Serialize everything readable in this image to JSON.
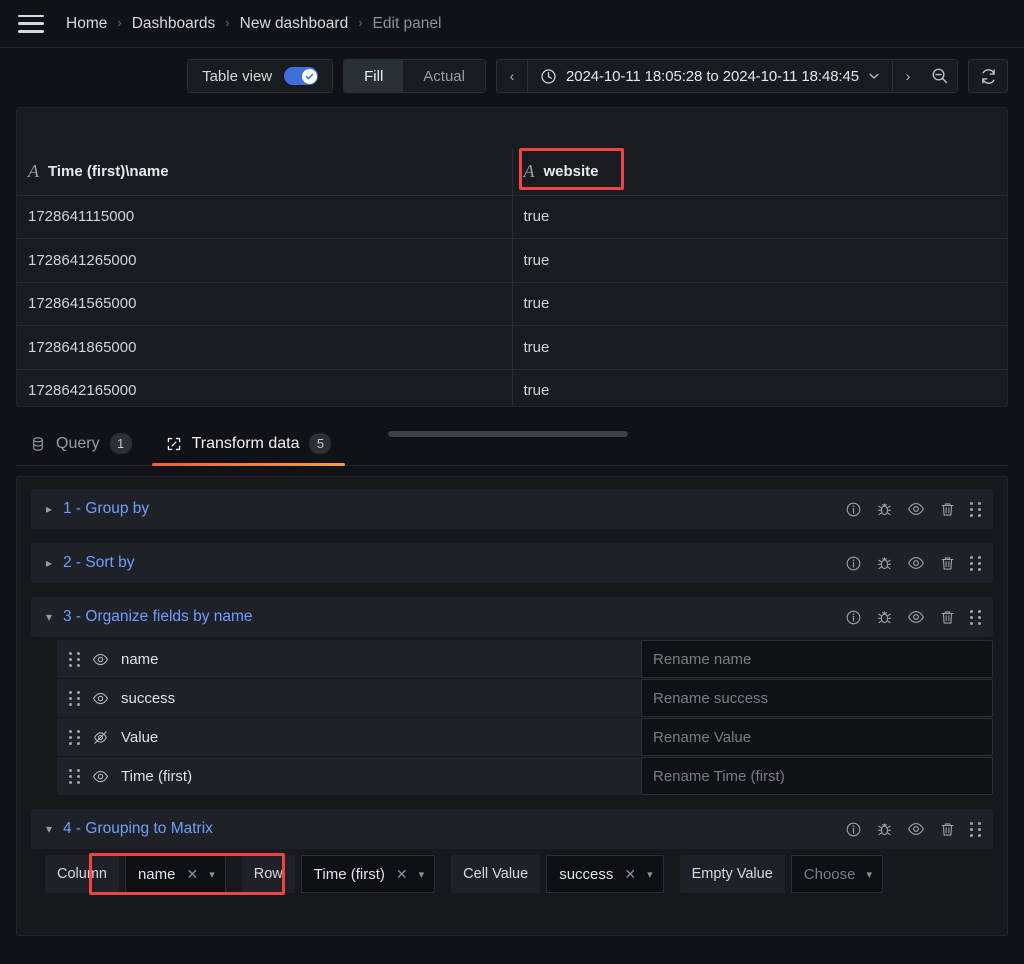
{
  "topbar": {
    "menu_icon": "hamburger-icon",
    "breadcrumbs": [
      {
        "label": "Home",
        "current": false
      },
      {
        "label": "Dashboards",
        "current": false
      },
      {
        "label": "New dashboard",
        "current": false
      },
      {
        "label": "Edit panel",
        "current": true
      }
    ],
    "separator": "›"
  },
  "toolbar": {
    "table_view_label": "Table view",
    "table_view_enabled": true,
    "fill_label": "Fill",
    "actual_label": "Actual",
    "active_segment": "Fill",
    "time_prev": "‹",
    "time_next": "›",
    "time_range": "2024-10-11 18:05:28 to 2024-10-11 18:48:45",
    "clock_icon": "clock-icon",
    "caret_icon": "chevron-down-icon",
    "zoom_out_icon": "zoom-out-icon",
    "refresh_icon": "refresh-icon"
  },
  "table": {
    "columns": [
      {
        "label": "Time (first)\\name",
        "type_icon": "A",
        "highlighted": false
      },
      {
        "label": "website",
        "type_icon": "A",
        "highlighted": true
      }
    ],
    "rows": [
      [
        "1728641115000",
        "true"
      ],
      [
        "1728641265000",
        "true"
      ],
      [
        "1728641565000",
        "true"
      ],
      [
        "1728641865000",
        "true"
      ],
      [
        "1728642165000",
        "true"
      ]
    ]
  },
  "tabs": [
    {
      "label": "Query",
      "count": "1",
      "icon": "database-icon",
      "active": false
    },
    {
      "label": "Transform data",
      "count": "5",
      "icon": "transform-icon",
      "active": true
    }
  ],
  "transformations": [
    {
      "title": "1 - Group by",
      "expanded": false,
      "actions": [
        "info-icon",
        "bug-icon",
        "eye-icon",
        "trash-icon",
        "drag-handle-icon"
      ]
    },
    {
      "title": "2 - Sort by",
      "expanded": false,
      "actions": [
        "info-icon",
        "bug-icon",
        "eye-icon",
        "trash-icon",
        "drag-handle-icon"
      ]
    },
    {
      "title": "3 - Organize fields by name",
      "expanded": true,
      "actions": [
        "info-icon",
        "bug-icon",
        "eye-icon",
        "trash-icon",
        "drag-handle-icon"
      ],
      "fields": [
        {
          "name": "name",
          "visible": true,
          "rename_placeholder": "Rename name",
          "rename_value": ""
        },
        {
          "name": "success",
          "visible": true,
          "rename_placeholder": "Rename success",
          "rename_value": ""
        },
        {
          "name": "Value",
          "visible": false,
          "rename_placeholder": "Rename Value",
          "rename_value": ""
        },
        {
          "name": "Time (first)",
          "visible": true,
          "rename_placeholder": "Rename Time (first)",
          "rename_value": ""
        }
      ]
    },
    {
      "title": "4 - Grouping to Matrix",
      "expanded": true,
      "actions": [
        "info-icon",
        "bug-icon",
        "eye-icon",
        "trash-icon",
        "drag-handle-icon"
      ],
      "options": [
        {
          "label": "Column",
          "value": "name",
          "placeholder": false,
          "clearable": true,
          "highlighted": true
        },
        {
          "label": "Row",
          "value": "Time (first)",
          "placeholder": false,
          "clearable": true,
          "highlighted": false
        },
        {
          "label": "Cell Value",
          "value": "success",
          "placeholder": false,
          "clearable": true,
          "highlighted": false
        },
        {
          "label": "Empty Value",
          "value": "Choose",
          "placeholder": true,
          "clearable": false,
          "highlighted": false
        }
      ]
    }
  ],
  "colors": {
    "accent_blue": "#6e9fff",
    "toggle_on": "#3d71d9",
    "tab_underline": "#f55f3e",
    "highlight_red": "#f04444",
    "background": "#111217",
    "panel_background": "#181b1f"
  }
}
